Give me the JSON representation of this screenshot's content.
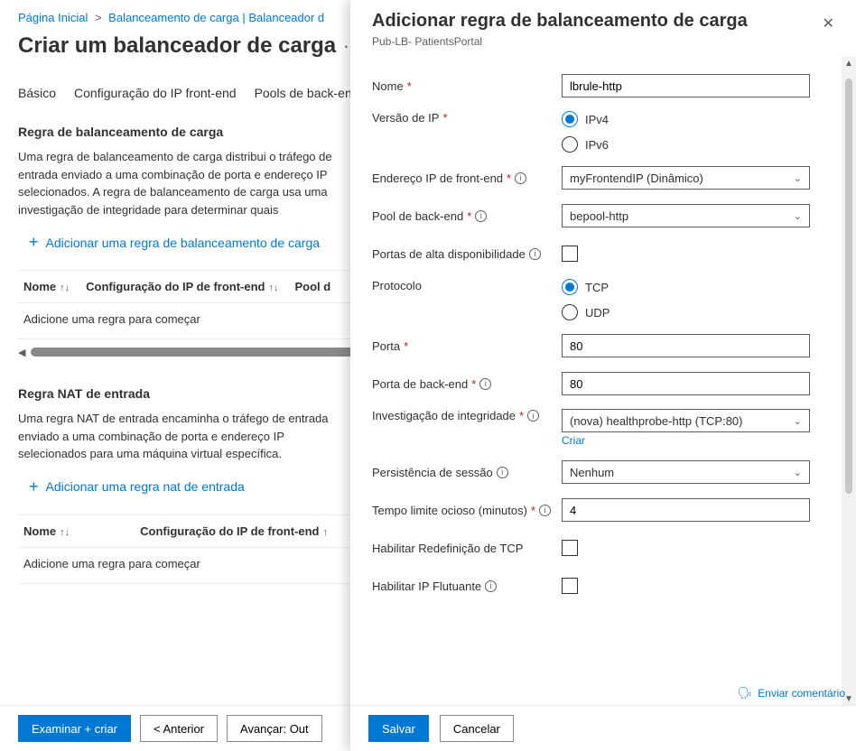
{
  "breadcrumb": {
    "home": "Página Inicial",
    "current": "Balanceamento de carga | Balanceador d"
  },
  "page_title": "Criar um balanceador de carga",
  "tabs": [
    "Básico",
    "Configuração do IP front-end",
    "Pools de back-end"
  ],
  "lb_rule": {
    "section_title": "Regra de balanceamento de carga",
    "desc": "Uma regra de balanceamento de carga distribui o tráfego de entrada enviado a uma combinação de porta e endereço IP selecionados. A regra de balanceamento de carga usa uma investigação de integridade para determinar quais",
    "add_label": "Adicionar uma regra de balanceamento de carga",
    "col_name": "Nome",
    "col_frontend": "Configuração do IP de front-end",
    "col_pool": "Pool d",
    "empty": "Adicione uma regra para começar"
  },
  "nat_rule": {
    "section_title": "Regra NAT de entrada",
    "desc": "Uma regra NAT de entrada encaminha o tráfego de entrada enviado a uma combinação de porta e endereço IP selecionados para uma máquina virtual específica.",
    "add_label": "Adicionar uma regra nat de entrada",
    "col_name": "Nome",
    "col_frontend": "Configuração do IP de front-end",
    "empty": "Adicione uma regra para começar"
  },
  "bottom": {
    "review": "Examinar + criar",
    "prev": "<   Anterior",
    "next": "Avançar: Out"
  },
  "panel": {
    "title": "Adicionar regra de balanceamento de carga",
    "subtitle": "Pub-LB- PatientsPortal",
    "labels": {
      "name": "Nome",
      "ip_version": "Versão de IP",
      "frontend_ip": "Endereço IP de front-end",
      "backend_pool": "Pool de back-end",
      "ha_ports": "Portas de alta disponibilidade",
      "protocol": "Protocolo",
      "port": "Porta",
      "backend_port": "Porta de back-end",
      "health_probe": "Investigação de integridade",
      "create_link": "Criar",
      "session_persistence": "Persistência de sessão",
      "idle_timeout": "Tempo limite ocioso (minutos)",
      "tcp_reset": "Habilitar Redefinição de TCP",
      "floating_ip": "Habilitar IP Flutuante"
    },
    "values": {
      "name": "lbrule-http",
      "ipv4": "IPv4",
      "ipv6": "IPv6",
      "frontend_ip": "myFrontendIP (Dinâmico)",
      "backend_pool": "bepool-http",
      "tcp": "TCP",
      "udp": "UDP",
      "port": "80",
      "backend_port": "80",
      "health_probe": "(nova) healthprobe-http (TCP:80)",
      "session_persistence": "Nenhum",
      "idle_timeout": "4"
    },
    "footer": {
      "save": "Salvar",
      "cancel": "Cancelar",
      "feedback": "Enviar comentário"
    }
  }
}
